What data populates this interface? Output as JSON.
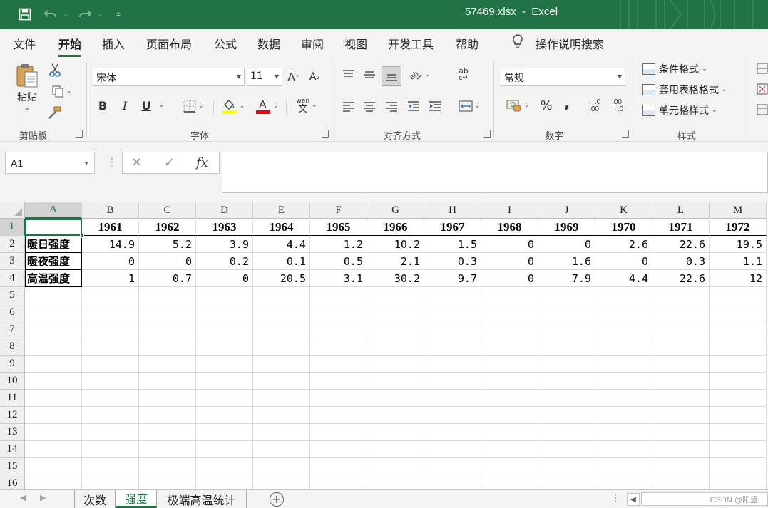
{
  "title_bar": {
    "title": "57469.xlsx  -  Excel",
    "quick_access": {
      "save_icon": "save-icon",
      "undo_icon": "undo-icon",
      "redo_icon": "redo-icon",
      "customize_icon": "customize-icon"
    },
    "brand_color": "#217346"
  },
  "menu": {
    "tabs": [
      "文件",
      "开始",
      "插入",
      "页面布局",
      "公式",
      "数据",
      "审阅",
      "视图",
      "开发工具",
      "帮助"
    ],
    "active": "开始",
    "search_label": "操作说明搜索"
  },
  "ribbon": {
    "clipboard": {
      "label": "剪贴板",
      "paste": "粘贴"
    },
    "font": {
      "label": "字体",
      "font_name": "宋体",
      "font_size": "11",
      "bold": "B",
      "italic": "I",
      "underline": "U",
      "grow": "A",
      "shrink": "A",
      "fill_color": "#ffff00",
      "font_color": "#ff0000",
      "phonetic_top": "wén",
      "phonetic_bottom": "文"
    },
    "alignment": {
      "label": "对齐方式",
      "wrap": "ab"
    },
    "number": {
      "label": "数字",
      "format": "常规",
      "percent": "%",
      "comma": ",",
      "inc_decimal": "←.0 .00",
      "dec_decimal": ".00 →.0"
    },
    "styles": {
      "label": "样式",
      "conditional": "条件格式",
      "table": "套用表格格式",
      "cell": "单元格样式"
    }
  },
  "formula_bar": {
    "name_box": "A1",
    "cancel": "✕",
    "enter": "✓",
    "fx": "fx",
    "content": ""
  },
  "sheet": {
    "columns": [
      "A",
      "B",
      "C",
      "D",
      "E",
      "F",
      "G",
      "H",
      "I",
      "J",
      "K",
      "L",
      "M"
    ],
    "rows": [
      "1",
      "2",
      "3",
      "4",
      "5",
      "6",
      "7",
      "8",
      "9",
      "10",
      "11",
      "12",
      "13",
      "14",
      "15",
      "16"
    ],
    "selected_cell": "A1",
    "header_row": [
      "",
      "1961",
      "1962",
      "1963",
      "1964",
      "1965",
      "1966",
      "1967",
      "1968",
      "1969",
      "1970",
      "1971",
      "1972"
    ],
    "data_rows": [
      [
        "暖日强度",
        "14.9",
        "5.2",
        "3.9",
        "4.4",
        "1.2",
        "10.2",
        "1.5",
        "0",
        "0",
        "2.6",
        "22.6",
        "19.5"
      ],
      [
        "暖夜强度",
        "0",
        "0",
        "0.2",
        "0.1",
        "0.5",
        "2.1",
        "0.3",
        "0",
        "1.6",
        "0",
        "0.3",
        "1.1"
      ],
      [
        "高温强度",
        "1",
        "0.7",
        "0",
        "20.5",
        "3.1",
        "30.2",
        "9.7",
        "0",
        "7.9",
        "4.4",
        "22.6",
        "12"
      ]
    ]
  },
  "sheet_tabs": {
    "tabs": [
      "次数",
      "强度",
      "极端高温统计"
    ],
    "active": "强度",
    "add_label": "+"
  },
  "watermark": "CSDN @阳望"
}
